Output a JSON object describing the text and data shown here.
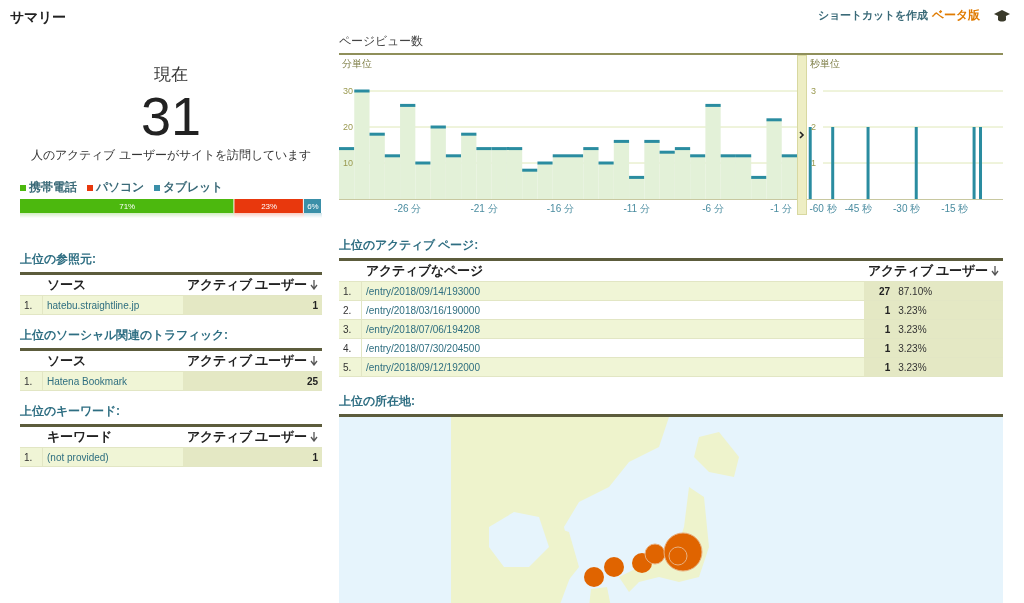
{
  "header": {
    "title": "サマリー",
    "shortcut_link": "ショートカットを作成",
    "beta_badge": "ベータ版"
  },
  "active_users": {
    "heading": "現在",
    "count": "31",
    "caption": "人のアクティブ ユーザーがサイトを訪問しています",
    "device_chart": {
      "chart_data": {
        "type": "bar",
        "orientation": "horizontal",
        "stacked": true,
        "xlim": [
          0,
          100
        ],
        "series": [
          {
            "name": "携帯電話",
            "color": "#4cb80e",
            "values": [
              71
            ],
            "value_labels": [
              "71%"
            ]
          },
          {
            "name": "パソコン",
            "color": "#e8380d",
            "values": [
              23
            ],
            "value_labels": [
              "23%"
            ]
          },
          {
            "name": "タブレット",
            "color": "#3a8fa8",
            "values": [
              6
            ],
            "value_labels": [
              "6%"
            ]
          }
        ]
      }
    }
  },
  "pageviews": {
    "title": "ページビュー数",
    "per_minute": {
      "label": "分単位",
      "chart_data": {
        "type": "bar",
        "x": [
          -30,
          -29,
          -28,
          -27,
          -26,
          -25,
          -24,
          -23,
          -22,
          -21,
          -20,
          -19,
          -18,
          -17,
          -16,
          -15,
          -14,
          -13,
          -12,
          -11,
          -10,
          -9,
          -8,
          -7,
          -6,
          -5,
          -4,
          -3,
          -2,
          -1
        ],
        "values": [
          14,
          30,
          18,
          12,
          26,
          10,
          20,
          12,
          18,
          14,
          14,
          14,
          8,
          10,
          12,
          12,
          14,
          10,
          16,
          6,
          16,
          13,
          14,
          12,
          26,
          12,
          12,
          6,
          22,
          12
        ],
        "xlim": [
          -30.5,
          -0.5
        ],
        "ylim": [
          0,
          40
        ],
        "grid": true,
        "yticks": [
          10,
          20,
          30
        ],
        "xticks": [
          {
            "value": -26,
            "label": "-26 分"
          },
          {
            "value": -21,
            "label": "-21 分"
          },
          {
            "value": -16,
            "label": "-16 分"
          },
          {
            "value": -11,
            "label": "-11 分"
          },
          {
            "value": -6,
            "label": "-6 分"
          },
          {
            "value": -1,
            "label": "-1 分"
          }
        ]
      }
    },
    "per_second": {
      "label": "秒単位",
      "chart_data": {
        "type": "bar",
        "x": [
          -60,
          -53,
          -42,
          -27,
          -9,
          -7
        ],
        "values": [
          2,
          2,
          2,
          2,
          2,
          2
        ],
        "xlim": [
          -61,
          0
        ],
        "ylim": [
          0,
          4
        ],
        "grid": true,
        "yticks": [
          1,
          2,
          3
        ],
        "xticks": [
          {
            "value": -60,
            "label": "-60 秒"
          },
          {
            "value": -45,
            "label": "-45 秒"
          },
          {
            "value": -30,
            "label": "-30 秒"
          },
          {
            "value": -15,
            "label": "-15 秒"
          }
        ]
      }
    }
  },
  "referrers": {
    "title": "上位の参照元:",
    "columns": [
      "ソース",
      "アクティブ ユーザー"
    ],
    "rows": [
      {
        "index": "1.",
        "name": "hatebu.straightline.jp",
        "users": "1"
      }
    ]
  },
  "social": {
    "title": "上位のソーシャル関連のトラフィック:",
    "columns": [
      "ソース",
      "アクティブ ユーザー"
    ],
    "rows": [
      {
        "index": "1.",
        "name": "Hatena Bookmark",
        "users": "25"
      }
    ]
  },
  "keywords": {
    "title": "上位のキーワード:",
    "columns": [
      "キーワード",
      "アクティブ ユーザー"
    ],
    "rows": [
      {
        "index": "1.",
        "name": "(not provided)",
        "users": "1"
      }
    ]
  },
  "active_pages": {
    "title": "上位のアクティブ ページ:",
    "columns": [
      "アクティブなページ",
      "アクティブ ユーザー"
    ],
    "rows": [
      {
        "index": "1.",
        "page": "/entry/2018/09/14/193000",
        "users": "27",
        "share": "87.10%"
      },
      {
        "index": "2.",
        "page": "/entry/2018/03/16/190000",
        "users": "1",
        "share": "3.23%"
      },
      {
        "index": "3.",
        "page": "/entry/2018/07/06/194208",
        "users": "1",
        "share": "3.23%"
      },
      {
        "index": "4.",
        "page": "/entry/2018/07/30/204500",
        "users": "1",
        "share": "3.23%"
      },
      {
        "index": "5.",
        "page": "/entry/2018/09/12/192000",
        "users": "1",
        "share": "3.23%"
      }
    ]
  },
  "locations": {
    "title": "上位の所在地:"
  }
}
